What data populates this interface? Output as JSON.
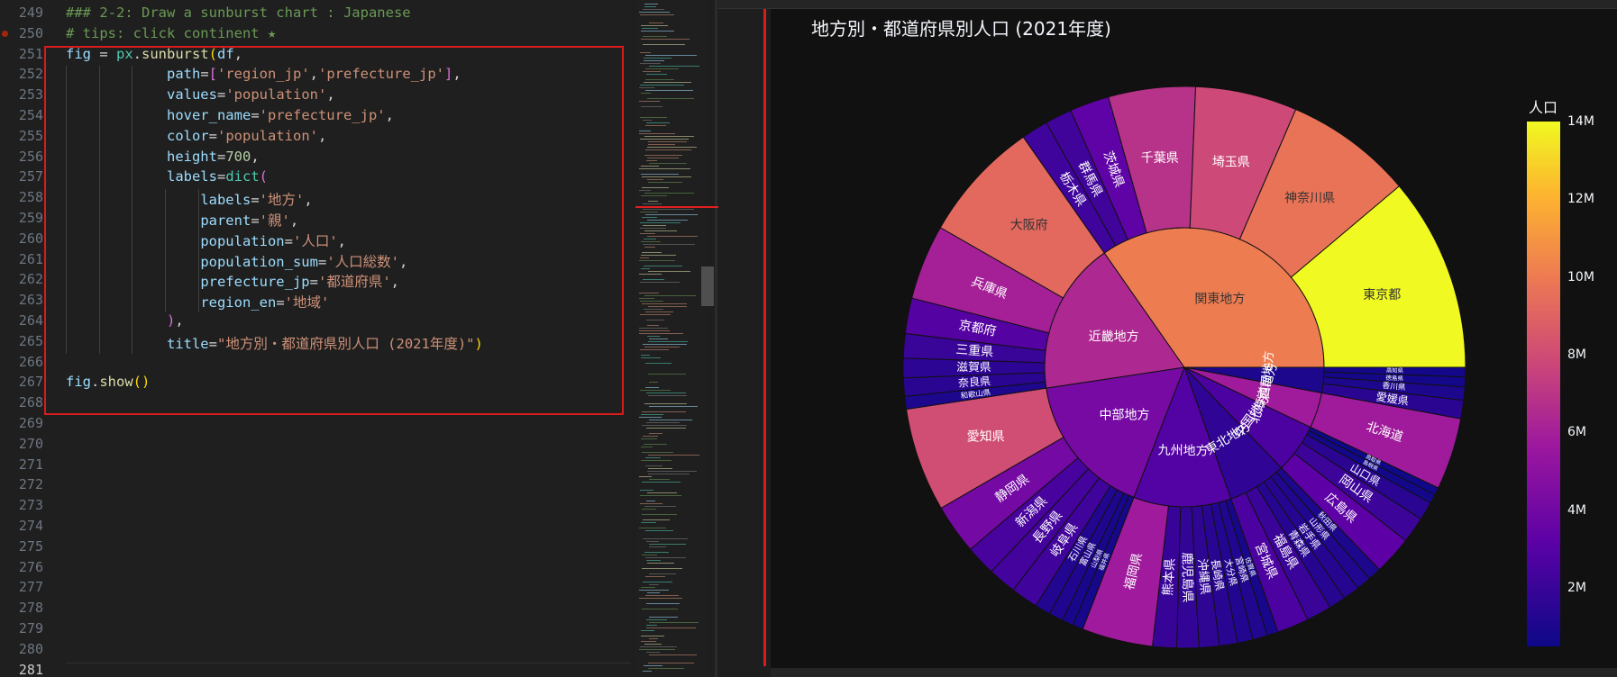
{
  "editor": {
    "line_numbers": [
      "249",
      "250",
      "251",
      "252",
      "253",
      "254",
      "255",
      "256",
      "257",
      "258",
      "259",
      "260",
      "261",
      "262",
      "263",
      "264",
      "265",
      "266",
      "267",
      "268",
      "269",
      "270",
      "271",
      "272",
      "273",
      "274",
      "275",
      "276",
      "277",
      "278",
      "279",
      "280",
      "281"
    ],
    "current_line": "281",
    "lines": [
      [
        [
          "### 2-2: Draw a sunburst chart : Japanese",
          "#6a9955"
        ]
      ],
      [
        [
          "# tips: click continent ★",
          "#6a9955"
        ]
      ],
      [
        [
          "fig",
          "#9cdcfe"
        ],
        [
          " = ",
          "#d4d4d4"
        ],
        [
          "px",
          "#4ec9b0"
        ],
        [
          ".",
          "#d4d4d4"
        ],
        [
          "sunburst",
          "#dcdcaa"
        ],
        [
          "(",
          "#ffd700"
        ],
        [
          "df",
          "#9cdcfe"
        ],
        [
          ",",
          "#d4d4d4"
        ]
      ],
      [
        [
          "            ",
          "#d4d4d4"
        ],
        [
          "path",
          "#9cdcfe"
        ],
        [
          "=",
          "#d4d4d4"
        ],
        [
          "[",
          "#da70d6"
        ],
        [
          "'region_jp'",
          "#ce9178"
        ],
        [
          ",",
          "#d4d4d4"
        ],
        [
          "'prefecture_jp'",
          "#ce9178"
        ],
        [
          "]",
          "#da70d6"
        ],
        [
          ",",
          "#d4d4d4"
        ]
      ],
      [
        [
          "            ",
          "#d4d4d4"
        ],
        [
          "values",
          "#9cdcfe"
        ],
        [
          "=",
          "#d4d4d4"
        ],
        [
          "'population'",
          "#ce9178"
        ],
        [
          ",",
          "#d4d4d4"
        ]
      ],
      [
        [
          "            ",
          "#d4d4d4"
        ],
        [
          "hover_name",
          "#9cdcfe"
        ],
        [
          "=",
          "#d4d4d4"
        ],
        [
          "'prefecture_jp'",
          "#ce9178"
        ],
        [
          ",",
          "#d4d4d4"
        ]
      ],
      [
        [
          "            ",
          "#d4d4d4"
        ],
        [
          "color",
          "#9cdcfe"
        ],
        [
          "=",
          "#d4d4d4"
        ],
        [
          "'population'",
          "#ce9178"
        ],
        [
          ",",
          "#d4d4d4"
        ]
      ],
      [
        [
          "            ",
          "#d4d4d4"
        ],
        [
          "height",
          "#9cdcfe"
        ],
        [
          "=",
          "#d4d4d4"
        ],
        [
          "700",
          "#b5cea8"
        ],
        [
          ",",
          "#d4d4d4"
        ]
      ],
      [
        [
          "            ",
          "#d4d4d4"
        ],
        [
          "labels",
          "#9cdcfe"
        ],
        [
          "=",
          "#d4d4d4"
        ],
        [
          "dict",
          "#4ec9b0"
        ],
        [
          "(",
          "#da70d6"
        ]
      ],
      [
        [
          "                ",
          "#d4d4d4"
        ],
        [
          "labels",
          "#9cdcfe"
        ],
        [
          "=",
          "#d4d4d4"
        ],
        [
          "'地方'",
          "#ce9178"
        ],
        [
          ",",
          "#d4d4d4"
        ]
      ],
      [
        [
          "                ",
          "#d4d4d4"
        ],
        [
          "parent",
          "#9cdcfe"
        ],
        [
          "=",
          "#d4d4d4"
        ],
        [
          "'親'",
          "#ce9178"
        ],
        [
          ",",
          "#d4d4d4"
        ]
      ],
      [
        [
          "                ",
          "#d4d4d4"
        ],
        [
          "population",
          "#9cdcfe"
        ],
        [
          "=",
          "#d4d4d4"
        ],
        [
          "'人口'",
          "#ce9178"
        ],
        [
          ",",
          "#d4d4d4"
        ]
      ],
      [
        [
          "                ",
          "#d4d4d4"
        ],
        [
          "population_sum",
          "#9cdcfe"
        ],
        [
          "=",
          "#d4d4d4"
        ],
        [
          "'人口総数'",
          "#ce9178"
        ],
        [
          ",",
          "#d4d4d4"
        ]
      ],
      [
        [
          "                ",
          "#d4d4d4"
        ],
        [
          "prefecture_jp",
          "#9cdcfe"
        ],
        [
          "=",
          "#d4d4d4"
        ],
        [
          "'都道府県'",
          "#ce9178"
        ],
        [
          ",",
          "#d4d4d4"
        ]
      ],
      [
        [
          "                ",
          "#d4d4d4"
        ],
        [
          "region_en",
          "#9cdcfe"
        ],
        [
          "=",
          "#d4d4d4"
        ],
        [
          "'地域'",
          "#ce9178"
        ]
      ],
      [
        [
          "            ",
          "#d4d4d4"
        ],
        [
          ")",
          "#da70d6"
        ],
        [
          ",",
          "#d4d4d4"
        ]
      ],
      [
        [
          "            ",
          "#d4d4d4"
        ],
        [
          "title",
          "#9cdcfe"
        ],
        [
          "=",
          "#d4d4d4"
        ],
        [
          "\"地方別・都道府県別人口 (2021年度)\"",
          "#ce9178"
        ],
        [
          ")",
          "#ffd700"
        ]
      ],
      [],
      [
        [
          "fig",
          "#9cdcfe"
        ],
        [
          ".",
          "#d4d4d4"
        ],
        [
          "show",
          "#dcdcaa"
        ],
        [
          "()",
          "#ffd700"
        ]
      ]
    ]
  },
  "plot": {
    "title": "地方別・都道府県別人口 (2021年度)",
    "colorbar_title": "人口",
    "colorbar_ticks": [
      {
        "label": "14M",
        "value": 14
      },
      {
        "label": "12M",
        "value": 12
      },
      {
        "label": "10M",
        "value": 10
      },
      {
        "label": "8M",
        "value": 8
      },
      {
        "label": "6M",
        "value": 6
      },
      {
        "label": "4M",
        "value": 4
      },
      {
        "label": "2M",
        "value": 2
      }
    ],
    "colorscale": [
      "#0d0887",
      "#5c01a6",
      "#9c179e",
      "#cc4778",
      "#ed7953",
      "#fdb42f",
      "#f0f921"
    ]
  },
  "chart_data": {
    "type": "sunburst",
    "title": "地方別・都道府県別人口 (2021年度)",
    "color_range_millions": [
      0.5,
      14
    ],
    "regions": [
      {
        "name": "四国地方",
        "color_m": 0.95,
        "children": [
          {
            "name": "高知県",
            "value": 0.69,
            "color_m": 0.69
          },
          {
            "name": "徳島県",
            "value": 0.72,
            "color_m": 0.72
          },
          {
            "name": "香川県",
            "value": 0.95,
            "color_m": 0.95
          },
          {
            "name": "愛媛県",
            "value": 1.33,
            "color_m": 1.33
          }
        ]
      },
      {
        "name": "北海道地方",
        "color_m": 5.18,
        "children": [
          {
            "name": "北海道",
            "value": 5.18,
            "color_m": 5.18
          }
        ]
      },
      {
        "name": "中国地方",
        "color_m": 2.3,
        "children": [
          {
            "name": "鳥取県",
            "value": 0.55,
            "color_m": 0.55
          },
          {
            "name": "島根県",
            "value": 0.66,
            "color_m": 0.66
          },
          {
            "name": "山口県",
            "value": 1.33,
            "color_m": 1.33
          },
          {
            "name": "岡山県",
            "value": 1.88,
            "color_m": 1.88
          },
          {
            "name": "広島県",
            "value": 2.78,
            "color_m": 2.78
          }
        ]
      },
      {
        "name": "東北地方",
        "color_m": 1.5,
        "children": [
          {
            "name": "秋田県",
            "value": 0.95,
            "color_m": 0.95
          },
          {
            "name": "山形県",
            "value": 1.06,
            "color_m": 1.06
          },
          {
            "name": "岩手県",
            "value": 1.2,
            "color_m": 1.2
          },
          {
            "name": "青森県",
            "value": 1.22,
            "color_m": 1.22
          },
          {
            "name": "福島県",
            "value": 1.81,
            "color_m": 1.81
          },
          {
            "name": "宮城県",
            "value": 2.29,
            "color_m": 2.29
          }
        ]
      },
      {
        "name": "九州地方",
        "color_m": 2.5,
        "children": [
          {
            "name": "佐賀県",
            "value": 0.81,
            "color_m": 0.81
          },
          {
            "name": "宮崎県",
            "value": 1.06,
            "color_m": 1.06
          },
          {
            "name": "大分県",
            "value": 1.12,
            "color_m": 1.12
          },
          {
            "name": "長崎県",
            "value": 1.3,
            "color_m": 1.3
          },
          {
            "name": "沖縄県",
            "value": 1.47,
            "color_m": 1.47
          },
          {
            "name": "鹿児島県",
            "value": 1.58,
            "color_m": 1.58
          },
          {
            "name": "熊本県",
            "value": 1.73,
            "color_m": 1.73
          },
          {
            "name": "福岡県",
            "value": 5.12,
            "color_m": 5.12
          }
        ]
      },
      {
        "name": "中部地方",
        "color_m": 3.7,
        "children": [
          {
            "name": "福井県",
            "value": 0.76,
            "color_m": 0.76
          },
          {
            "name": "山梨県",
            "value": 0.81,
            "color_m": 0.81
          },
          {
            "name": "富山県",
            "value": 1.03,
            "color_m": 1.03
          },
          {
            "name": "石川県",
            "value": 1.13,
            "color_m": 1.13
          },
          {
            "name": "岐阜県",
            "value": 1.96,
            "color_m": 1.96
          },
          {
            "name": "長野県",
            "value": 2.03,
            "color_m": 2.03
          },
          {
            "name": "新潟県",
            "value": 2.18,
            "color_m": 2.18
          },
          {
            "name": "静岡県",
            "value": 3.6,
            "color_m": 3.6
          },
          {
            "name": "愛知県",
            "value": 7.5,
            "color_m": 7.5
          }
        ]
      },
      {
        "name": "近畿地方",
        "color_m": 5.8,
        "children": [
          {
            "name": "和歌山県",
            "value": 0.92,
            "color_m": 0.92
          },
          {
            "name": "奈良県",
            "value": 1.32,
            "color_m": 1.32
          },
          {
            "name": "滋賀県",
            "value": 1.41,
            "color_m": 1.41
          },
          {
            "name": "三重県",
            "value": 1.76,
            "color_m": 1.76
          },
          {
            "name": "京都府",
            "value": 2.56,
            "color_m": 2.56
          },
          {
            "name": "兵庫県",
            "value": 5.43,
            "color_m": 5.43
          },
          {
            "name": "大阪府",
            "value": 8.8,
            "color_m": 8.8
          }
        ]
      },
      {
        "name": "関東地方",
        "color_m": 9.6,
        "children": [
          {
            "name": "栃木県",
            "value": 1.93,
            "color_m": 1.93
          },
          {
            "name": "群馬県",
            "value": 1.94,
            "color_m": 1.94
          },
          {
            "name": "茨城県",
            "value": 2.85,
            "color_m": 2.85
          },
          {
            "name": "千葉県",
            "value": 6.27,
            "color_m": 6.27
          },
          {
            "name": "埼玉県",
            "value": 7.34,
            "color_m": 7.34
          },
          {
            "name": "神奈川県",
            "value": 9.24,
            "color_m": 9.24
          },
          {
            "name": "東京都",
            "value": 14.01,
            "color_m": 14.01
          }
        ]
      }
    ]
  }
}
